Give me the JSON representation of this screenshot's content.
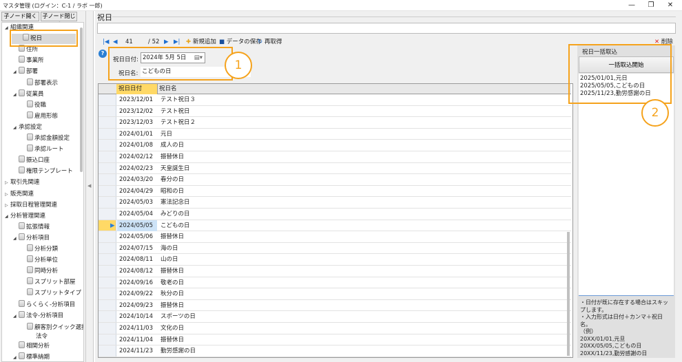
{
  "window": {
    "title": "マスタ管理 (ログイン：C-1 / ラボ 一郎)",
    "min": "—",
    "restore": "❐",
    "close": "✕"
  },
  "left": {
    "expand_btn": "子ノード開く",
    "collapse_btn": "子ノード閉じる",
    "tree": [
      {
        "label": "組織関連",
        "level": 0,
        "arrow": "◢",
        "icon": false
      },
      {
        "label": "祝日",
        "level": 1,
        "arrow": "",
        "icon": true,
        "selected": true
      },
      {
        "label": "住所",
        "level": 1,
        "arrow": "",
        "icon": true
      },
      {
        "label": "事業所",
        "level": 1,
        "arrow": "",
        "icon": true
      },
      {
        "label": "部署",
        "level": 1,
        "arrow": "◢",
        "icon": true
      },
      {
        "label": "部署表示",
        "level": 2,
        "arrow": "",
        "icon": true
      },
      {
        "label": "従業員",
        "level": 1,
        "arrow": "◢",
        "icon": true
      },
      {
        "label": "役職",
        "level": 2,
        "arrow": "",
        "icon": true
      },
      {
        "label": "雇用形態",
        "level": 2,
        "arrow": "",
        "icon": true
      },
      {
        "label": "承認設定",
        "level": 1,
        "arrow": "◢",
        "icon": false
      },
      {
        "label": "承認金額設定",
        "level": 2,
        "arrow": "",
        "icon": true
      },
      {
        "label": "承認ルート",
        "level": 2,
        "arrow": "",
        "icon": true
      },
      {
        "label": "振込口座",
        "level": 1,
        "arrow": "",
        "icon": true
      },
      {
        "label": "権限テンプレート",
        "level": 1,
        "arrow": "",
        "icon": true
      },
      {
        "label": "取引先関連",
        "level": 0,
        "arrow": "▷",
        "icon": false
      },
      {
        "label": "販売関連",
        "level": 0,
        "arrow": "▷",
        "icon": false
      },
      {
        "label": "採取日程管理関連",
        "level": 0,
        "arrow": "▷",
        "icon": false
      },
      {
        "label": "分析管理関連",
        "level": 0,
        "arrow": "◢",
        "icon": false
      },
      {
        "label": "拡張情報",
        "level": 1,
        "arrow": "",
        "icon": true
      },
      {
        "label": "分析項目",
        "level": 1,
        "arrow": "◢",
        "icon": true
      },
      {
        "label": "分析分類",
        "level": 2,
        "arrow": "",
        "icon": true
      },
      {
        "label": "分析単位",
        "level": 2,
        "arrow": "",
        "icon": true
      },
      {
        "label": "同時分析",
        "level": 2,
        "arrow": "",
        "icon": true
      },
      {
        "label": "スプリット部屋",
        "level": 2,
        "arrow": "",
        "icon": true
      },
      {
        "label": "スプリットタイプ",
        "level": 2,
        "arrow": "",
        "icon": true
      },
      {
        "label": "らくらく-分析項目",
        "level": 1,
        "arrow": "",
        "icon": true
      },
      {
        "label": "法令-分析項目",
        "level": 1,
        "arrow": "◢",
        "icon": true
      },
      {
        "label": "顧客別クイック選択",
        "label2": "法令",
        "level": 2,
        "arrow": "",
        "icon": true
      },
      {
        "label": "相関分析",
        "level": 1,
        "arrow": "",
        "icon": true
      },
      {
        "label": "標準納期",
        "level": 1,
        "arrow": "◢",
        "icon": true
      }
    ]
  },
  "main": {
    "title": "祝日",
    "nav": {
      "position": "41",
      "total": "/ 52",
      "add": "新規追加",
      "save": "データの保存",
      "reload": "再取得",
      "delete": "削除"
    },
    "form": {
      "date_label": "祝日日付:",
      "date_value": "2024年  5月  5日",
      "name_label": "祝日名:",
      "name_value": "こどもの日"
    },
    "callouts": [
      "1",
      "2"
    ],
    "grid": {
      "headers": [
        "祝日日付",
        "祝日名"
      ],
      "current_index": 10,
      "rows": [
        [
          "2023/12/01",
          "テスト祝日３"
        ],
        [
          "2023/12/02",
          "テスト祝日"
        ],
        [
          "2023/12/03",
          "テスト祝日２"
        ],
        [
          "2024/01/01",
          "元日"
        ],
        [
          "2024/01/08",
          "成人の日"
        ],
        [
          "2024/02/12",
          "振替休日"
        ],
        [
          "2024/02/23",
          "天皇誕生日"
        ],
        [
          "2024/03/20",
          "春分の日"
        ],
        [
          "2024/04/29",
          "昭和の日"
        ],
        [
          "2024/05/03",
          "憲法記念日"
        ],
        [
          "2024/05/04",
          "みどりの日"
        ],
        [
          "2024/05/05",
          "こどもの日"
        ],
        [
          "2024/05/06",
          "振替休日"
        ],
        [
          "2024/07/15",
          "海の日"
        ],
        [
          "2024/08/11",
          "山の日"
        ],
        [
          "2024/08/12",
          "振替休日"
        ],
        [
          "2024/09/16",
          "敬老の日"
        ],
        [
          "2024/09/22",
          "秋分の日"
        ],
        [
          "2024/09/23",
          "振替休日"
        ],
        [
          "2024/10/14",
          "スポーツの日"
        ],
        [
          "2024/11/03",
          "文化の日"
        ],
        [
          "2024/11/04",
          "振替休日"
        ],
        [
          "2024/11/23",
          "勤労感謝の日"
        ]
      ]
    }
  },
  "bulk": {
    "title": "祝日一括取込",
    "start_btn": "一括取込開始",
    "input_lines": [
      "2025/01/01,元日",
      "2025/05/05,こどもの日",
      "2025/11/23,勤労感謝の日"
    ],
    "help_lines": [
      "・日付が既に存在する場合はスキップします。",
      "・入力形式は日付＋カンマ＋祝日名。",
      "（例）",
      "20XX/01/01,元旦",
      "20XX/05/05,こどもの日",
      "20XX/11/23,勤労感謝の日"
    ]
  },
  "colors": {
    "highlight": "#f5a21b",
    "selected_header": "#ffd966"
  }
}
